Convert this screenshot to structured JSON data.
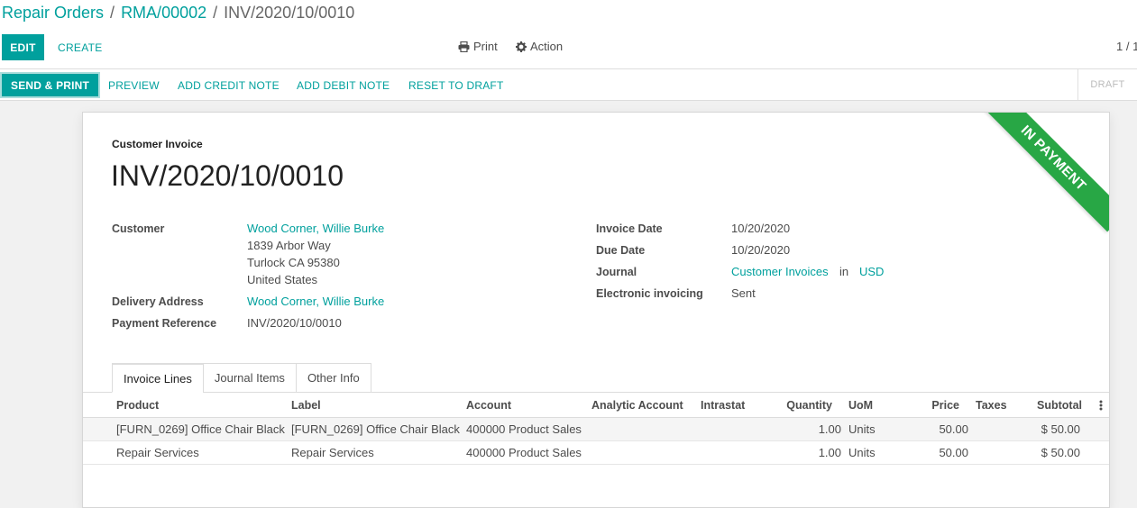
{
  "breadcrumb": {
    "items": [
      "Repair Orders",
      "RMA/00002"
    ],
    "separator": "/",
    "current": "INV/2020/10/0010"
  },
  "toolbar": {
    "edit_label": "EDIT",
    "create_label": "CREATE",
    "print_label": "Print",
    "action_label": "Action",
    "pager": "1 / 1"
  },
  "statusbar": {
    "buttons": [
      "SEND & PRINT",
      "PREVIEW",
      "ADD CREDIT NOTE",
      "ADD DEBIT NOTE",
      "RESET TO DRAFT"
    ],
    "stage": "DRAFT"
  },
  "sheet": {
    "ribbon": "IN PAYMENT",
    "doc_type": "Customer Invoice",
    "name": "INV/2020/10/0010",
    "left_fields": {
      "customer_label": "Customer",
      "customer_name": "Wood Corner, Willie Burke",
      "address_line1": "1839 Arbor Way",
      "address_line2": "Turlock CA 95380",
      "address_line3": "United States",
      "delivery_label": "Delivery Address",
      "delivery_value": "Wood Corner, Willie Burke",
      "payment_ref_label": "Payment Reference",
      "payment_ref_value": "INV/2020/10/0010"
    },
    "right_fields": {
      "invoice_date_label": "Invoice Date",
      "invoice_date_value": "10/20/2020",
      "due_date_label": "Due Date",
      "due_date_value": "10/20/2020",
      "journal_label": "Journal",
      "journal_value": "Customer Invoices",
      "journal_in": "in",
      "currency": "USD",
      "einvoicing_label": "Electronic invoicing",
      "einvoicing_value": "Sent"
    },
    "tabs": [
      "Invoice Lines",
      "Journal Items",
      "Other Info"
    ],
    "columns": {
      "product": "Product",
      "label": "Label",
      "account": "Account",
      "analytic": "Analytic Account",
      "intrastat": "Intrastat",
      "quantity": "Quantity",
      "uom": "UoM",
      "price": "Price",
      "taxes": "Taxes",
      "subtotal": "Subtotal"
    },
    "rows": [
      {
        "product": "[FURN_0269] Office Chair Black",
        "label": "[FURN_0269] Office Chair Black",
        "account": "400000 Product Sales",
        "analytic": "",
        "intrastat": "",
        "quantity": "1.00",
        "uom": "Units",
        "price": "50.00",
        "taxes": "",
        "subtotal": "$ 50.00"
      },
      {
        "product": "Repair Services",
        "label": "Repair Services",
        "account": "400000 Product Sales",
        "analytic": "",
        "intrastat": "",
        "quantity": "1.00",
        "uom": "Units",
        "price": "50.00",
        "taxes": "",
        "subtotal": "$ 50.00"
      }
    ]
  },
  "colors": {
    "primary": "#00A09D",
    "ribbon": "#28a745",
    "text": "#4c4c4c",
    "background": "#f1f1f1"
  },
  "icons": {
    "print": "printer-icon",
    "action": "gear-icon",
    "column_options": "vertical-ellipsis-icon"
  }
}
